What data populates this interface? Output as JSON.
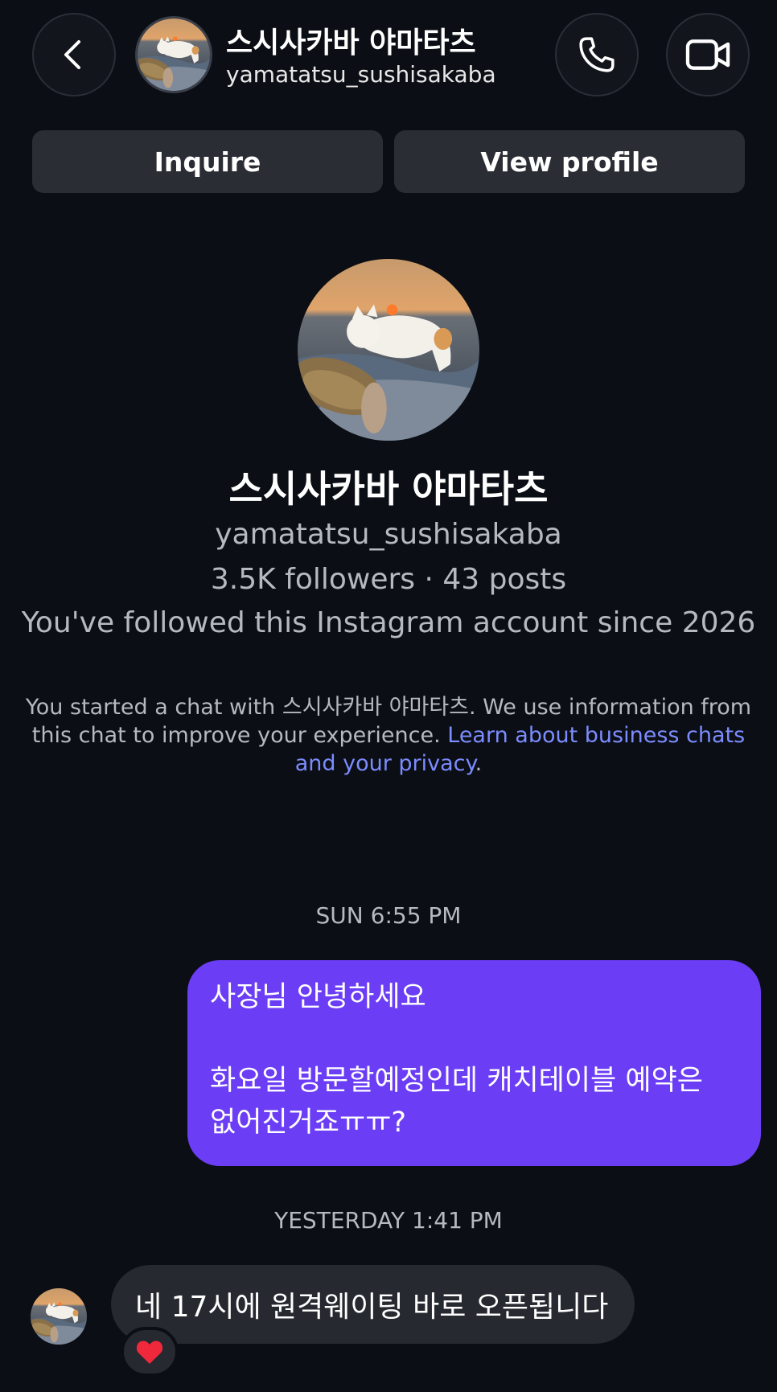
{
  "header": {
    "name": "스시사카바 야마타츠",
    "username": "yamatatsu_sushisakaba",
    "back_icon": "chevron-left-icon",
    "call_icon": "phone-icon",
    "video_icon": "video-camera-icon"
  },
  "actions": {
    "inquire_label": "Inquire",
    "view_profile_label": "View profile"
  },
  "profile": {
    "name": "스시사카바 야마타츠",
    "username": "yamatatsu_sushisakaba",
    "stats": "3.5K followers · 43 posts",
    "follow_since": "You've followed this Instagram account since 2026"
  },
  "notice": {
    "text": "You started a chat with 스시사카바 야마타츠. We use information from this chat to improve your experience. ",
    "link": "Learn about business chats and your privacy",
    "suffix": "."
  },
  "messages": {
    "timestamp1": "SUN 6:55 PM",
    "outgoing_line1": "사장님 안녕하세요",
    "outgoing_line2": "",
    "outgoing_line3": "화요일 방문할예정인데 캐치테이블 예약은",
    "outgoing_line4": "없어진거죠ㅠㅠ?",
    "timestamp2": "YESTERDAY 1:41 PM",
    "incoming": "네 17시에 원격웨이팅 바로 오픈됩니다",
    "reaction": "❤️"
  },
  "colors": {
    "background": "#0b0e14",
    "outgoing_bubble": "#6b3ef5",
    "incoming_bubble": "#262930",
    "link": "#7c8cff"
  }
}
